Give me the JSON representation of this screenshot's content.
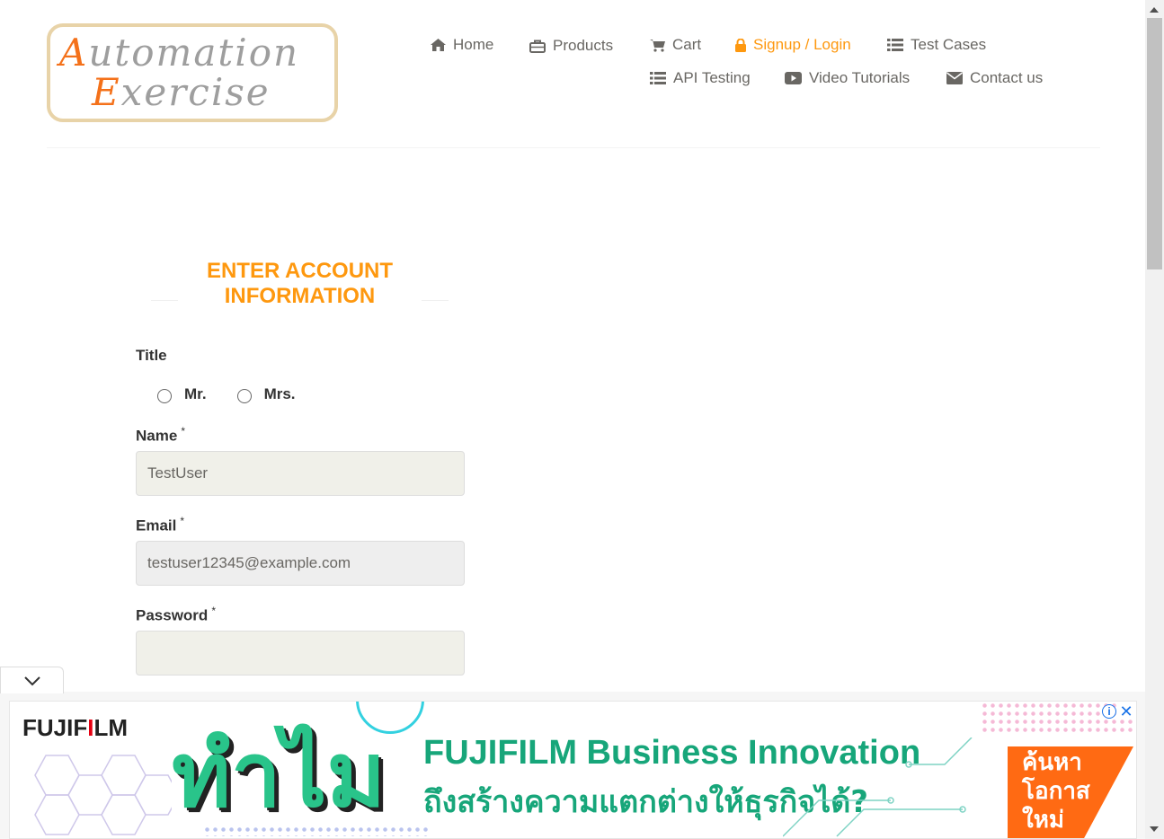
{
  "logo": {
    "line1": "Automation",
    "line2": "Exercise"
  },
  "nav": {
    "home": "Home",
    "products": "Products",
    "cart": "Cart",
    "signup_login": "Signup / Login",
    "test_cases": "Test Cases",
    "api_testing": "API Testing",
    "video_tutorials": "Video Tutorials",
    "contact_us": "Contact us",
    "active_color": "#fe980f"
  },
  "form": {
    "title_line1": "ENTER ACCOUNT",
    "title_line2": "INFORMATION",
    "title_label": "Title",
    "radio_mr": "Mr.",
    "radio_mrs": "Mrs.",
    "name_label": "Name",
    "name_value": "TestUser",
    "email_label": "Email",
    "email_value": "testuser12345@example.com",
    "password_label": "Password",
    "password_value": "",
    "required_mark": "*"
  },
  "ad": {
    "brand": "FUJIFILM",
    "thai_big": "ทำไม",
    "headline": "FUJIFILM Business Innovation",
    "subline": "ถึงสร้างความแตกต่างให้ธุรกิจได้?",
    "cta_line1": "ค้นหา",
    "cta_line2": "โอกาส",
    "cta_line3": "ใหม่",
    "info_glyph": "i",
    "close_glyph": "✕"
  }
}
